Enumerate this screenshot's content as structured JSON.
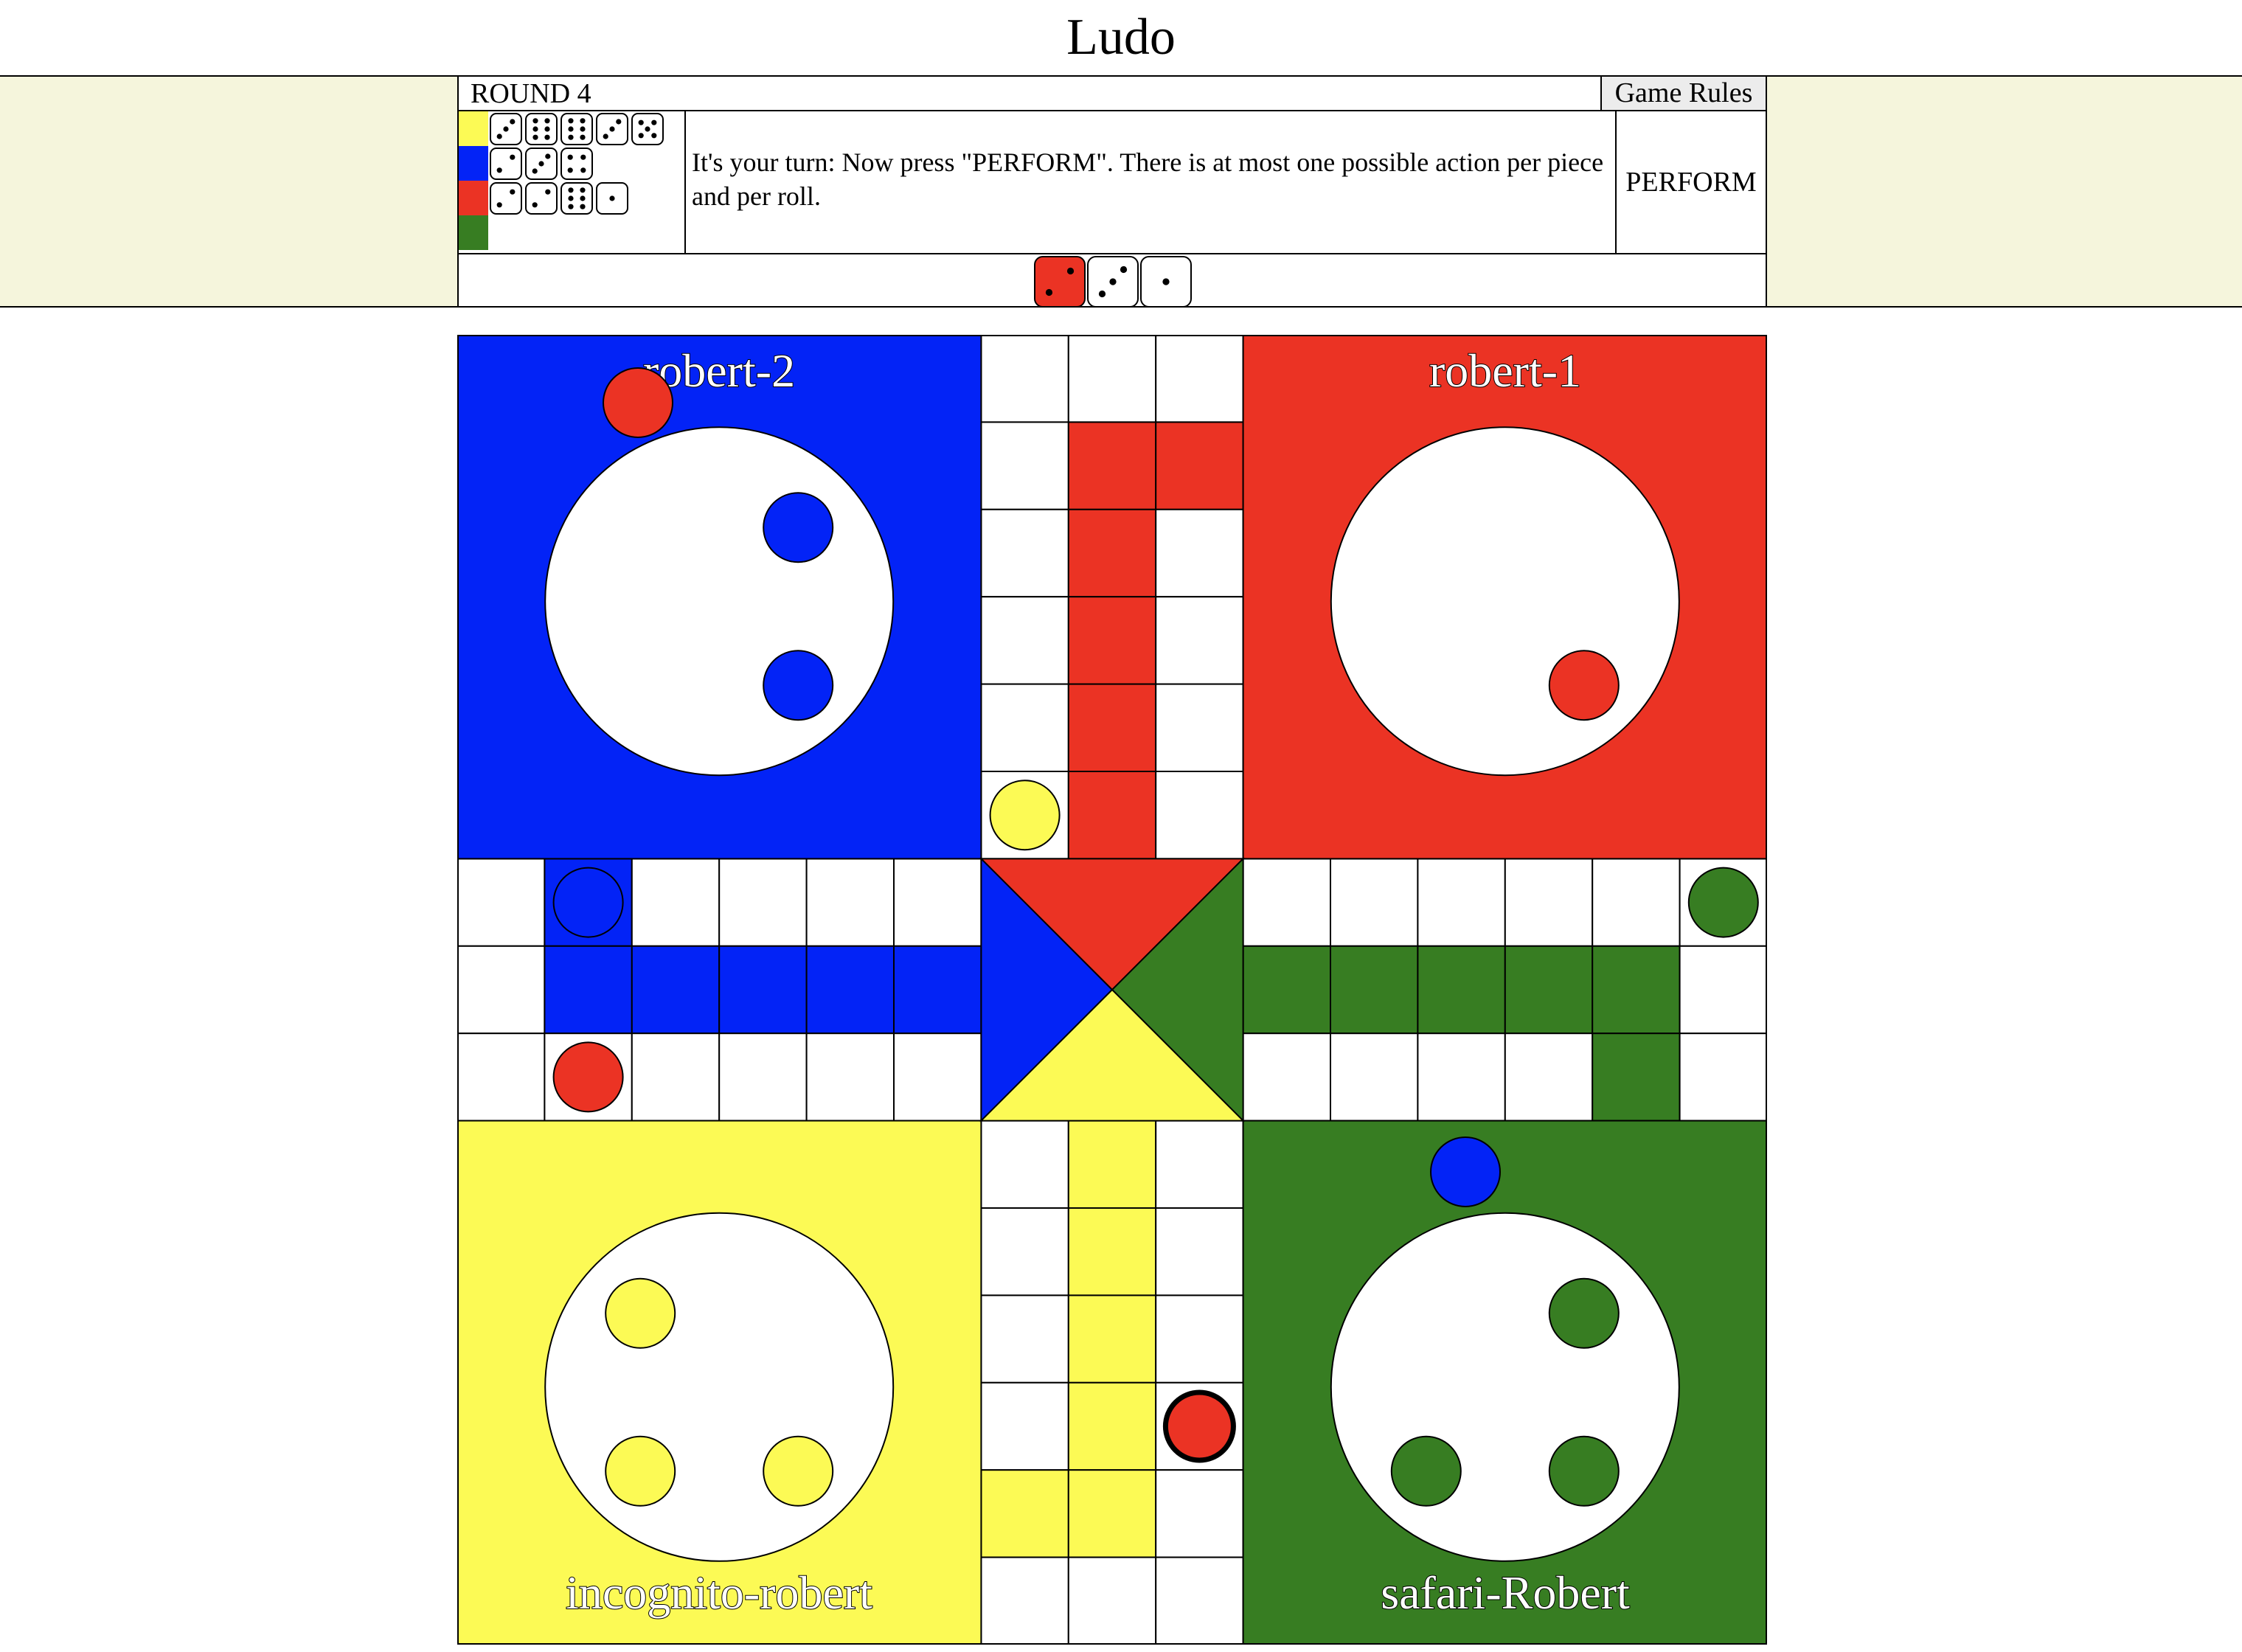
{
  "page": {
    "title": "Ludo"
  },
  "header": {
    "round_label": "ROUND 4",
    "rules_label": "Game Rules",
    "message": "It's your turn: Now press \"PERFORM\". There is at most one possible action per piece and per roll.",
    "perform_label": "PERFORM"
  },
  "roll_history": [
    {
      "player_color": "yellow",
      "swatch_hex": "#fcfa55",
      "dice": [
        3,
        6,
        6,
        3,
        5
      ]
    },
    {
      "player_color": "blue",
      "swatch_hex": "#0323f6",
      "dice": [
        2,
        3,
        4
      ]
    },
    {
      "player_color": "red",
      "swatch_hex": "#eb3324",
      "dice": [
        2,
        2,
        6,
        1
      ]
    },
    {
      "player_color": "green",
      "swatch_hex": "#377d22",
      "dice": []
    }
  ],
  "current_dice": [
    {
      "value": 2,
      "color": "red"
    },
    {
      "value": 3,
      "color": "white"
    },
    {
      "value": 1,
      "color": "white"
    }
  ],
  "colors": {
    "yellow": "#fcfa55",
    "blue": "#0323f6",
    "red": "#eb3324",
    "green": "#377d22",
    "band": "#f5f5dc"
  },
  "players": {
    "blue": {
      "name": "robert-2"
    },
    "red": {
      "name": "robert-1"
    },
    "yellow": {
      "name": "incognito-robert"
    },
    "green": {
      "name": "safari-Robert"
    }
  },
  "home_pieces": {
    "blue": [
      "top-right",
      "bottom-right"
    ],
    "red": [
      "bottom-right"
    ],
    "yellow": [
      "top-left",
      "bottom-left",
      "bottom-right"
    ],
    "green": [
      "top-right",
      "bottom-left",
      "bottom-right"
    ]
  },
  "track_pieces": [
    {
      "color": "blue",
      "square": [
        1,
        6
      ]
    },
    {
      "color": "red",
      "square": [
        1,
        8
      ],
      "outlined": true
    },
    {
      "color": "yellow",
      "square": [
        6,
        5
      ]
    },
    {
      "color": "red",
      "square": [
        8,
        12
      ],
      "highlighted": true
    },
    {
      "color": "green",
      "square": [
        14,
        6
      ]
    }
  ],
  "waiting_pieces": [
    {
      "color": "red",
      "near": "blue-yard"
    },
    {
      "color": "blue",
      "near": "green-yard"
    }
  ]
}
